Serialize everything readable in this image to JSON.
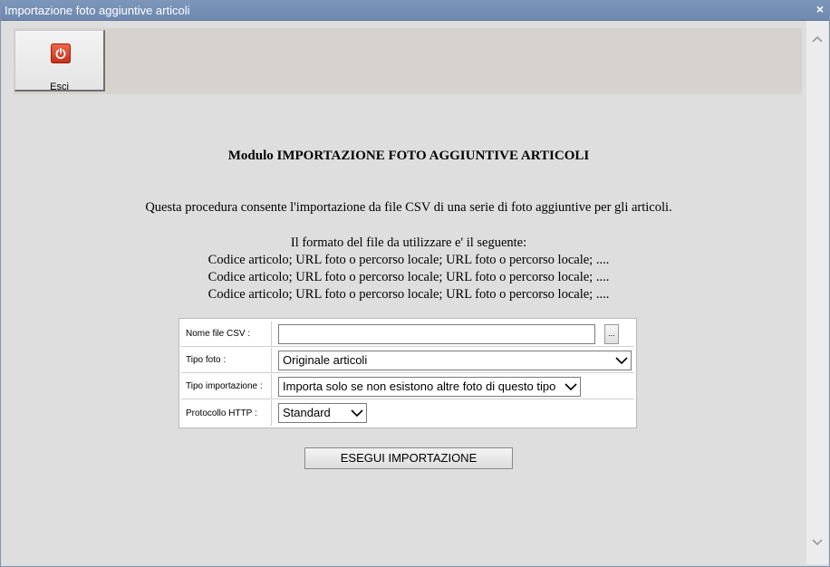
{
  "window": {
    "title": "Importazione foto aggiuntive articoli",
    "close_symbol": "×"
  },
  "toolbar": {
    "exit_label": "Esci",
    "exit_icon": "power-icon"
  },
  "heading": "Modulo IMPORTAZIONE FOTO AGGIUNTIVE ARTICOLI",
  "description": "Questa procedura consente l'importazione da file CSV di una serie di foto aggiuntive per gli articoli.",
  "format": {
    "intro": "Il formato del file da utilizzare e' il seguente:",
    "lines": [
      "Codice articolo; URL foto o percorso locale; URL foto o percorso locale; ....",
      "Codice articolo; URL foto o percorso locale; URL foto o percorso locale; ....",
      "Codice articolo; URL foto o percorso locale; URL foto o percorso locale; ...."
    ]
  },
  "form": {
    "file_label": "Nome file CSV :",
    "file_value": "",
    "browse_label": "...",
    "photo_type_label": "Tipo foto :",
    "photo_type_value": "Originale articoli",
    "import_type_label": "Tipo importazione :",
    "import_type_value": "Importa solo se non esistono altre foto di questo tipo",
    "protocol_label": "Protocollo HTTP :",
    "protocol_value": "Standard"
  },
  "run_button": "ESEGUI IMPORTAZIONE",
  "colors": {
    "titlebar": "#7489b0",
    "background": "#dedede",
    "toolbar": "#d6d3ce",
    "exit_icon": "#d84a2e"
  }
}
